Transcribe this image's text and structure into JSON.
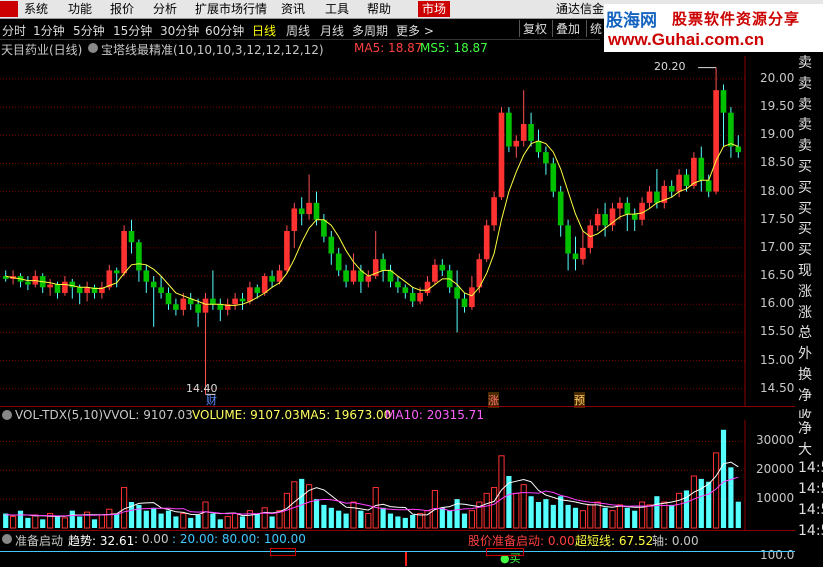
{
  "menubar": {
    "items": [
      "系统",
      "功能",
      "报价",
      "分析",
      "扩展市场行情",
      "资讯",
      "工具",
      "帮助"
    ],
    "active_item": "市场",
    "broker": "通达信金"
  },
  "brand": {
    "name": "股海网",
    "tagline": "股票软件资源分享",
    "url": "www.Guhai.com.cn"
  },
  "periods": {
    "items": [
      "分时",
      "1分钟",
      "5分钟",
      "15分钟",
      "30分钟",
      "60分钟",
      "日线",
      "周线",
      "月线",
      "多周期",
      "更多 >"
    ],
    "active": "日线"
  },
  "right_buttons": [
    "复权",
    "叠加",
    "统"
  ],
  "main_header": {
    "stock": "天目药业(日线)",
    "indicator": "宝塔线最精准(10,10,10,3,12,12,12,12)",
    "ma5": "MA5: 18.87",
    "ms5": "MS5: 18.87"
  },
  "price_axis": [
    "20.00",
    "19.50",
    "19.00",
    "18.50",
    "18.00",
    "17.50",
    "17.00",
    "16.50",
    "16.00",
    "15.50",
    "15.00",
    "14.50"
  ],
  "annotations": {
    "high": "20.20",
    "low": "14.40",
    "marker_cai": "财",
    "marker_zhang": "涨",
    "marker_yu": "预"
  },
  "side_labels": [
    "卖五",
    "卖四",
    "卖三",
    "卖二",
    "卖一",
    "买一",
    "买二",
    "买三",
    "买四",
    "买五",
    "现价",
    "涨跌",
    "涨幅",
    "总量",
    "外盘",
    "换手",
    "净资",
    "收益"
  ],
  "side_labels2": [
    "净流",
    "大宗",
    "14:5",
    "14:5",
    "14:5",
    "14:5"
  ],
  "vol_header": {
    "name": "VOL-TDX(5,10)",
    "vvol": "VVOL: 9107.03",
    "volume": "VOLUME: 9107.03",
    "ma5": "MA5: 19673.00",
    "ma10": "MA10: 20315.71"
  },
  "vol_axis": [
    "30000",
    "20000",
    "10000"
  ],
  "bottom_header": {
    "name": "准备启动",
    "trend": "趋势: 32.61",
    "v1": ": 0.00",
    "v2": ": 20.00",
    "v3": ": 80.00",
    "v4": ": 100.00",
    "start": "股价准备启动: 0.00",
    "super": "超短线: 67.52",
    "axis": "轴: 0.00",
    "tick": "100.0",
    "buy_marker": "●买"
  },
  "chart_data": {
    "type": "candlestick",
    "ylim": [
      14.3,
      20.3
    ],
    "candles": [
      [
        16.5,
        16.45,
        16.6,
        16.4
      ],
      [
        16.45,
        16.5,
        16.6,
        16.35
      ],
      [
        16.5,
        16.4,
        16.55,
        16.3
      ],
      [
        16.4,
        16.35,
        16.5,
        16.25
      ],
      [
        16.35,
        16.5,
        16.6,
        16.3
      ],
      [
        16.5,
        16.3,
        16.55,
        16.2
      ],
      [
        16.3,
        16.35,
        16.45,
        16.15
      ],
      [
        16.35,
        16.2,
        16.4,
        16.1
      ],
      [
        16.2,
        16.4,
        16.5,
        16.15
      ],
      [
        16.4,
        16.3,
        16.45,
        16.1
      ],
      [
        16.3,
        16.2,
        16.35,
        16.0
      ],
      [
        16.2,
        16.3,
        16.4,
        16.05
      ],
      [
        16.3,
        16.2,
        16.35,
        16.1
      ],
      [
        16.2,
        16.3,
        16.4,
        16.1
      ],
      [
        16.3,
        16.6,
        16.7,
        16.25
      ],
      [
        16.6,
        16.55,
        16.65,
        16.3
      ],
      [
        16.55,
        17.3,
        17.4,
        16.5
      ],
      [
        17.3,
        17.1,
        17.5,
        16.9
      ],
      [
        17.1,
        16.6,
        17.15,
        16.4
      ],
      [
        16.6,
        16.4,
        16.7,
        16.2
      ],
      [
        16.4,
        16.3,
        16.5,
        15.6
      ],
      [
        16.3,
        16.2,
        16.5,
        16.1
      ],
      [
        16.2,
        16.0,
        16.3,
        15.9
      ],
      [
        16.0,
        15.9,
        16.1,
        15.8
      ],
      [
        15.9,
        16.1,
        16.2,
        15.8
      ],
      [
        16.1,
        16.0,
        16.2,
        15.9
      ],
      [
        16.0,
        15.85,
        16.1,
        15.6
      ],
      [
        15.85,
        16.1,
        16.2,
        14.4
      ],
      [
        16.1,
        16.0,
        16.6,
        15.9
      ],
      [
        16.0,
        15.9,
        16.1,
        15.7
      ],
      [
        15.9,
        16.0,
        16.1,
        15.8
      ],
      [
        16.0,
        16.1,
        16.2,
        15.9
      ],
      [
        16.1,
        16.05,
        16.2,
        15.9
      ],
      [
        16.05,
        16.3,
        16.4,
        16.0
      ],
      [
        16.3,
        16.2,
        16.35,
        16.1
      ],
      [
        16.2,
        16.5,
        16.55,
        16.15
      ],
      [
        16.5,
        16.4,
        16.6,
        16.3
      ],
      [
        16.4,
        16.6,
        16.7,
        16.35
      ],
      [
        16.6,
        17.3,
        17.4,
        16.55
      ],
      [
        17.3,
        17.7,
        17.8,
        17.0
      ],
      [
        17.7,
        17.6,
        17.9,
        17.4
      ],
      [
        17.6,
        17.8,
        18.3,
        17.5
      ],
      [
        17.8,
        17.5,
        18.0,
        17.4
      ],
      [
        17.5,
        17.2,
        17.6,
        17.1
      ],
      [
        17.2,
        16.9,
        17.3,
        16.7
      ],
      [
        16.9,
        16.6,
        17.0,
        16.5
      ],
      [
        16.6,
        16.4,
        16.7,
        16.3
      ],
      [
        16.4,
        16.6,
        16.9,
        16.35
      ],
      [
        16.6,
        16.4,
        16.7,
        16.2
      ],
      [
        16.4,
        16.5,
        16.6,
        16.3
      ],
      [
        16.5,
        16.8,
        17.3,
        16.45
      ],
      [
        16.8,
        16.6,
        16.9,
        16.4
      ],
      [
        16.6,
        16.4,
        16.7,
        16.3
      ],
      [
        16.4,
        16.3,
        16.5,
        16.2
      ],
      [
        16.3,
        16.2,
        16.35,
        16.1
      ],
      [
        16.2,
        16.05,
        16.3,
        15.95
      ],
      [
        16.05,
        16.2,
        16.3,
        16.0
      ],
      [
        16.2,
        16.4,
        16.5,
        16.15
      ],
      [
        16.4,
        16.7,
        16.8,
        16.35
      ],
      [
        16.7,
        16.6,
        16.8,
        16.5
      ],
      [
        16.6,
        16.3,
        16.7,
        16.2
      ],
      [
        16.3,
        16.1,
        16.6,
        15.5
      ],
      [
        16.1,
        15.95,
        16.2,
        15.85
      ],
      [
        15.95,
        16.3,
        16.5,
        15.9
      ],
      [
        16.3,
        16.8,
        16.9,
        16.2
      ],
      [
        16.8,
        17.4,
        17.5,
        16.75
      ],
      [
        17.4,
        17.9,
        18.0,
        17.3
      ],
      [
        17.9,
        19.4,
        19.5,
        17.85
      ],
      [
        19.4,
        18.8,
        19.5,
        18.7
      ],
      [
        18.8,
        18.9,
        19.0,
        18.6
      ],
      [
        18.9,
        19.2,
        19.8,
        18.8
      ],
      [
        19.2,
        18.9,
        19.4,
        18.8
      ],
      [
        18.9,
        18.7,
        19.1,
        18.6
      ],
      [
        18.7,
        18.5,
        18.8,
        18.3
      ],
      [
        18.5,
        18.0,
        18.6,
        17.9
      ],
      [
        18.0,
        17.4,
        18.1,
        17.2
      ],
      [
        17.4,
        16.9,
        17.5,
        16.6
      ],
      [
        16.9,
        16.8,
        17.2,
        16.6
      ],
      [
        16.8,
        17.0,
        17.3,
        16.7
      ],
      [
        17.0,
        17.4,
        17.5,
        16.9
      ],
      [
        17.4,
        17.6,
        17.7,
        17.3
      ],
      [
        17.6,
        17.4,
        17.8,
        17.2
      ],
      [
        17.4,
        17.7,
        17.8,
        17.3
      ],
      [
        17.7,
        17.8,
        17.9,
        17.5
      ],
      [
        17.8,
        17.6,
        17.9,
        17.3
      ],
      [
        17.6,
        17.5,
        17.7,
        17.3
      ],
      [
        17.5,
        17.8,
        17.9,
        17.4
      ],
      [
        17.8,
        18.0,
        18.1,
        17.7
      ],
      [
        18.0,
        17.8,
        18.4,
        17.7
      ],
      [
        17.8,
        18.1,
        18.2,
        17.7
      ],
      [
        18.1,
        18.0,
        18.2,
        17.9
      ],
      [
        18.0,
        18.3,
        18.4,
        17.9
      ],
      [
        18.3,
        18.1,
        18.4,
        18.0
      ],
      [
        18.1,
        18.6,
        18.7,
        18.05
      ],
      [
        18.6,
        18.2,
        18.8,
        18.0
      ],
      [
        18.2,
        18.0,
        18.3,
        17.9
      ],
      [
        18.0,
        19.8,
        20.2,
        17.95
      ],
      [
        19.8,
        19.4,
        19.9,
        18.8
      ],
      [
        19.4,
        18.8,
        19.5,
        18.6
      ],
      [
        18.8,
        18.7,
        19.0,
        18.6
      ]
    ],
    "ma_line": [
      16.5,
      16.47,
      16.45,
      16.42,
      16.42,
      16.4,
      16.38,
      16.35,
      16.35,
      16.33,
      16.3,
      16.3,
      16.28,
      16.28,
      16.33,
      16.38,
      16.55,
      16.7,
      16.72,
      16.7,
      16.62,
      16.5,
      16.35,
      16.2,
      16.15,
      16.1,
      16.05,
      16.0,
      16.0,
      16.0,
      15.98,
      15.98,
      16.0,
      16.05,
      16.12,
      16.2,
      16.3,
      16.38,
      16.55,
      16.8,
      17.1,
      17.35,
      17.5,
      17.5,
      17.4,
      17.2,
      16.95,
      16.75,
      16.6,
      16.5,
      16.55,
      16.6,
      16.6,
      16.5,
      16.4,
      16.3,
      16.25,
      16.25,
      16.35,
      16.45,
      16.45,
      16.35,
      16.2,
      16.15,
      16.3,
      16.55,
      16.9,
      17.5,
      18.0,
      18.35,
      18.65,
      18.85,
      18.9,
      18.85,
      18.7,
      18.4,
      18.0,
      17.6,
      17.3,
      17.2,
      17.25,
      17.35,
      17.45,
      17.55,
      17.6,
      17.6,
      17.62,
      17.7,
      17.8,
      17.85,
      17.9,
      18.0,
      18.05,
      18.15,
      18.2,
      18.2,
      18.55,
      18.8,
      18.85,
      18.8
    ],
    "volume": [
      5000,
      4000,
      6000,
      3500,
      4500,
      3000,
      5000,
      4000,
      3500,
      6000,
      4000,
      5500,
      3000,
      4500,
      6500,
      5000,
      14000,
      9000,
      8000,
      6000,
      7000,
      5000,
      6000,
      4000,
      5000,
      3500,
      4500,
      9000,
      5000,
      3000,
      4000,
      5000,
      4000,
      6000,
      5000,
      7000,
      4000,
      6000,
      12000,
      16000,
      17000,
      15000,
      10000,
      8000,
      7000,
      6000,
      5000,
      9000,
      6000,
      5000,
      14000,
      7000,
      5000,
      4000,
      3500,
      4500,
      5000,
      6000,
      13000,
      7000,
      6000,
      10000,
      5000,
      6000,
      9000,
      12000,
      14000,
      25000,
      18000,
      12000,
      15000,
      11000,
      9000,
      10000,
      8000,
      11000,
      8000,
      7000,
      6000,
      8000,
      9000,
      7000,
      6000,
      8000,
      7000,
      6000,
      9000,
      8000,
      11000,
      9000,
      8000,
      12000,
      13000,
      18000,
      17000,
      16000,
      26000,
      34000,
      21000,
      9100
    ],
    "vol_ylim": [
      0,
      36000
    ],
    "vol_ma5": [
      4600,
      4400,
      4600,
      4500,
      4200,
      4300,
      4100,
      4000,
      4100,
      4500,
      4500,
      4600,
      4600,
      4600,
      4700,
      4900,
      6600,
      7500,
      8500,
      8700,
      8800,
      7000,
      6400,
      5600,
      5400,
      4700,
      4600,
      5600,
      5300,
      5000,
      5100,
      5200,
      4300,
      4400,
      4800,
      5400,
      5200,
      5600,
      6800,
      9000,
      11000,
      13000,
      14000,
      13200,
      11200,
      9200,
      7200,
      7000,
      6600,
      6200,
      7800,
      8200,
      7400,
      7200,
      7100,
      4800,
      4500,
      4600,
      6400,
      7100,
      7400,
      8400,
      8200,
      7800,
      7400,
      8400,
      9200,
      13200,
      15600,
      16200,
      16800,
      16000,
      13000,
      11400,
      10600,
      9800,
      9400,
      9000,
      8400,
      8000,
      8000,
      7400,
      7200,
      7600,
      7400,
      7200,
      7200,
      7600,
      8200,
      8600,
      9000,
      9600,
      10600,
      12400,
      13600,
      15200,
      18000,
      22200,
      22800,
      21200
    ],
    "vol_ma10": [
      4600,
      4500,
      4500,
      4500,
      4400,
      4300,
      4300,
      4200,
      4200,
      4300,
      4400,
      4400,
      4400,
      4500,
      4600,
      4700,
      5600,
      6100,
      6600,
      6700,
      6800,
      6800,
      6900,
      6600,
      6700,
      5600,
      5500,
      5600,
      5400,
      5100,
      4900,
      5100,
      4800,
      4900,
      5000,
      5200,
      5000,
      5400,
      6200,
      7100,
      8000,
      9000,
      9600,
      9900,
      9800,
      9300,
      8600,
      8800,
      8300,
      7800,
      7100,
      6700,
      6500,
      6300,
      6300,
      6500,
      6300,
      6000,
      6800,
      6700,
      6000,
      6300,
      6600,
      6700,
      7200,
      7600,
      8200,
      10100,
      11600,
      12000,
      12300,
      12200,
      12000,
      12800,
      12300,
      11300,
      10700,
      9800,
      9300,
      8900,
      8700,
      8400,
      8000,
      7800,
      7500,
      7600,
      7600,
      7500,
      7800,
      7800,
      7700,
      8200,
      8900,
      10000,
      11000,
      11700,
      13500,
      16000,
      16800,
      17600
    ]
  }
}
